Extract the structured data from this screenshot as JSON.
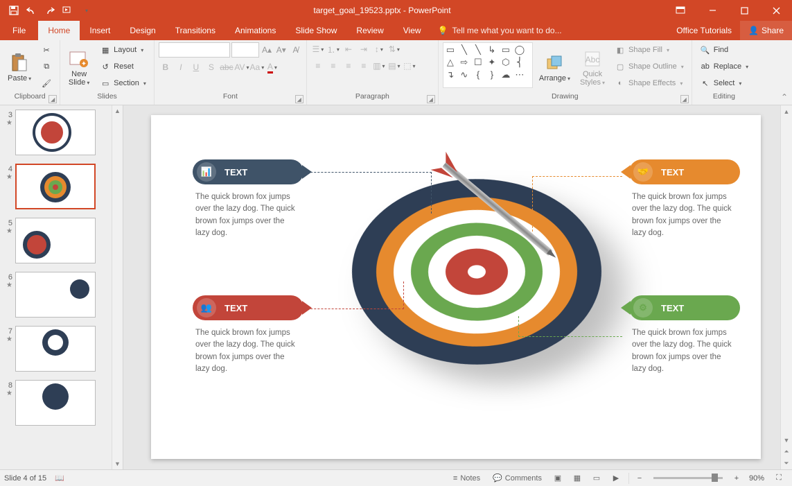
{
  "app": {
    "title": "target_goal_19523.pptx - PowerPoint"
  },
  "tabs": {
    "file": "File",
    "home": "Home",
    "insert": "Insert",
    "design": "Design",
    "transitions": "Transitions",
    "animations": "Animations",
    "slideshow": "Slide Show",
    "review": "Review",
    "view": "View",
    "tellme": "Tell me what you want to do...",
    "tutorials": "Office Tutorials",
    "share": "Share"
  },
  "ribbon": {
    "clipboard": {
      "label": "Clipboard",
      "paste": "Paste"
    },
    "slides": {
      "label": "Slides",
      "new": "New\nSlide",
      "layout": "Layout",
      "reset": "Reset",
      "section": "Section"
    },
    "font": {
      "label": "Font"
    },
    "paragraph": {
      "label": "Paragraph"
    },
    "drawing": {
      "label": "Drawing",
      "arrange": "Arrange",
      "quick": "Quick\nStyles",
      "shapefill": "Shape Fill",
      "shapeoutline": "Shape Outline",
      "shapeeffects": "Shape Effects"
    },
    "editing": {
      "label": "Editing",
      "find": "Find",
      "replace": "Replace",
      "select": "Select"
    }
  },
  "thumbs": {
    "items": [
      {
        "n": "3"
      },
      {
        "n": "4"
      },
      {
        "n": "5"
      },
      {
        "n": "6"
      },
      {
        "n": "7"
      },
      {
        "n": "8"
      }
    ]
  },
  "slide": {
    "callouts": {
      "tl": {
        "title": "TEXT",
        "desc": "The quick brown fox jumps over the lazy dog. The quick brown fox jumps over the lazy dog.",
        "color": "#3f5368"
      },
      "bl": {
        "title": "TEXT",
        "desc": "The quick brown fox jumps over the lazy dog. The quick brown fox jumps over the lazy dog.",
        "color": "#c2453a"
      },
      "tr": {
        "title": "TEXT",
        "desc": "The quick brown fox jumps over the lazy dog. The quick brown fox jumps over the lazy dog.",
        "color": "#e68a2e"
      },
      "br": {
        "title": "TEXT",
        "desc": "The quick brown fox jumps over the lazy dog. The quick brown fox jumps over the lazy dog.",
        "color": "#6aa84f"
      }
    },
    "rings": [
      "#2e3e55",
      "#e68a2e",
      "#ffffff",
      "#6aa84f",
      "#ffffff",
      "#c2453a"
    ]
  },
  "status": {
    "slide": "Slide 4 of 15",
    "notes": "Notes",
    "comments": "Comments",
    "zoom": "90%"
  }
}
